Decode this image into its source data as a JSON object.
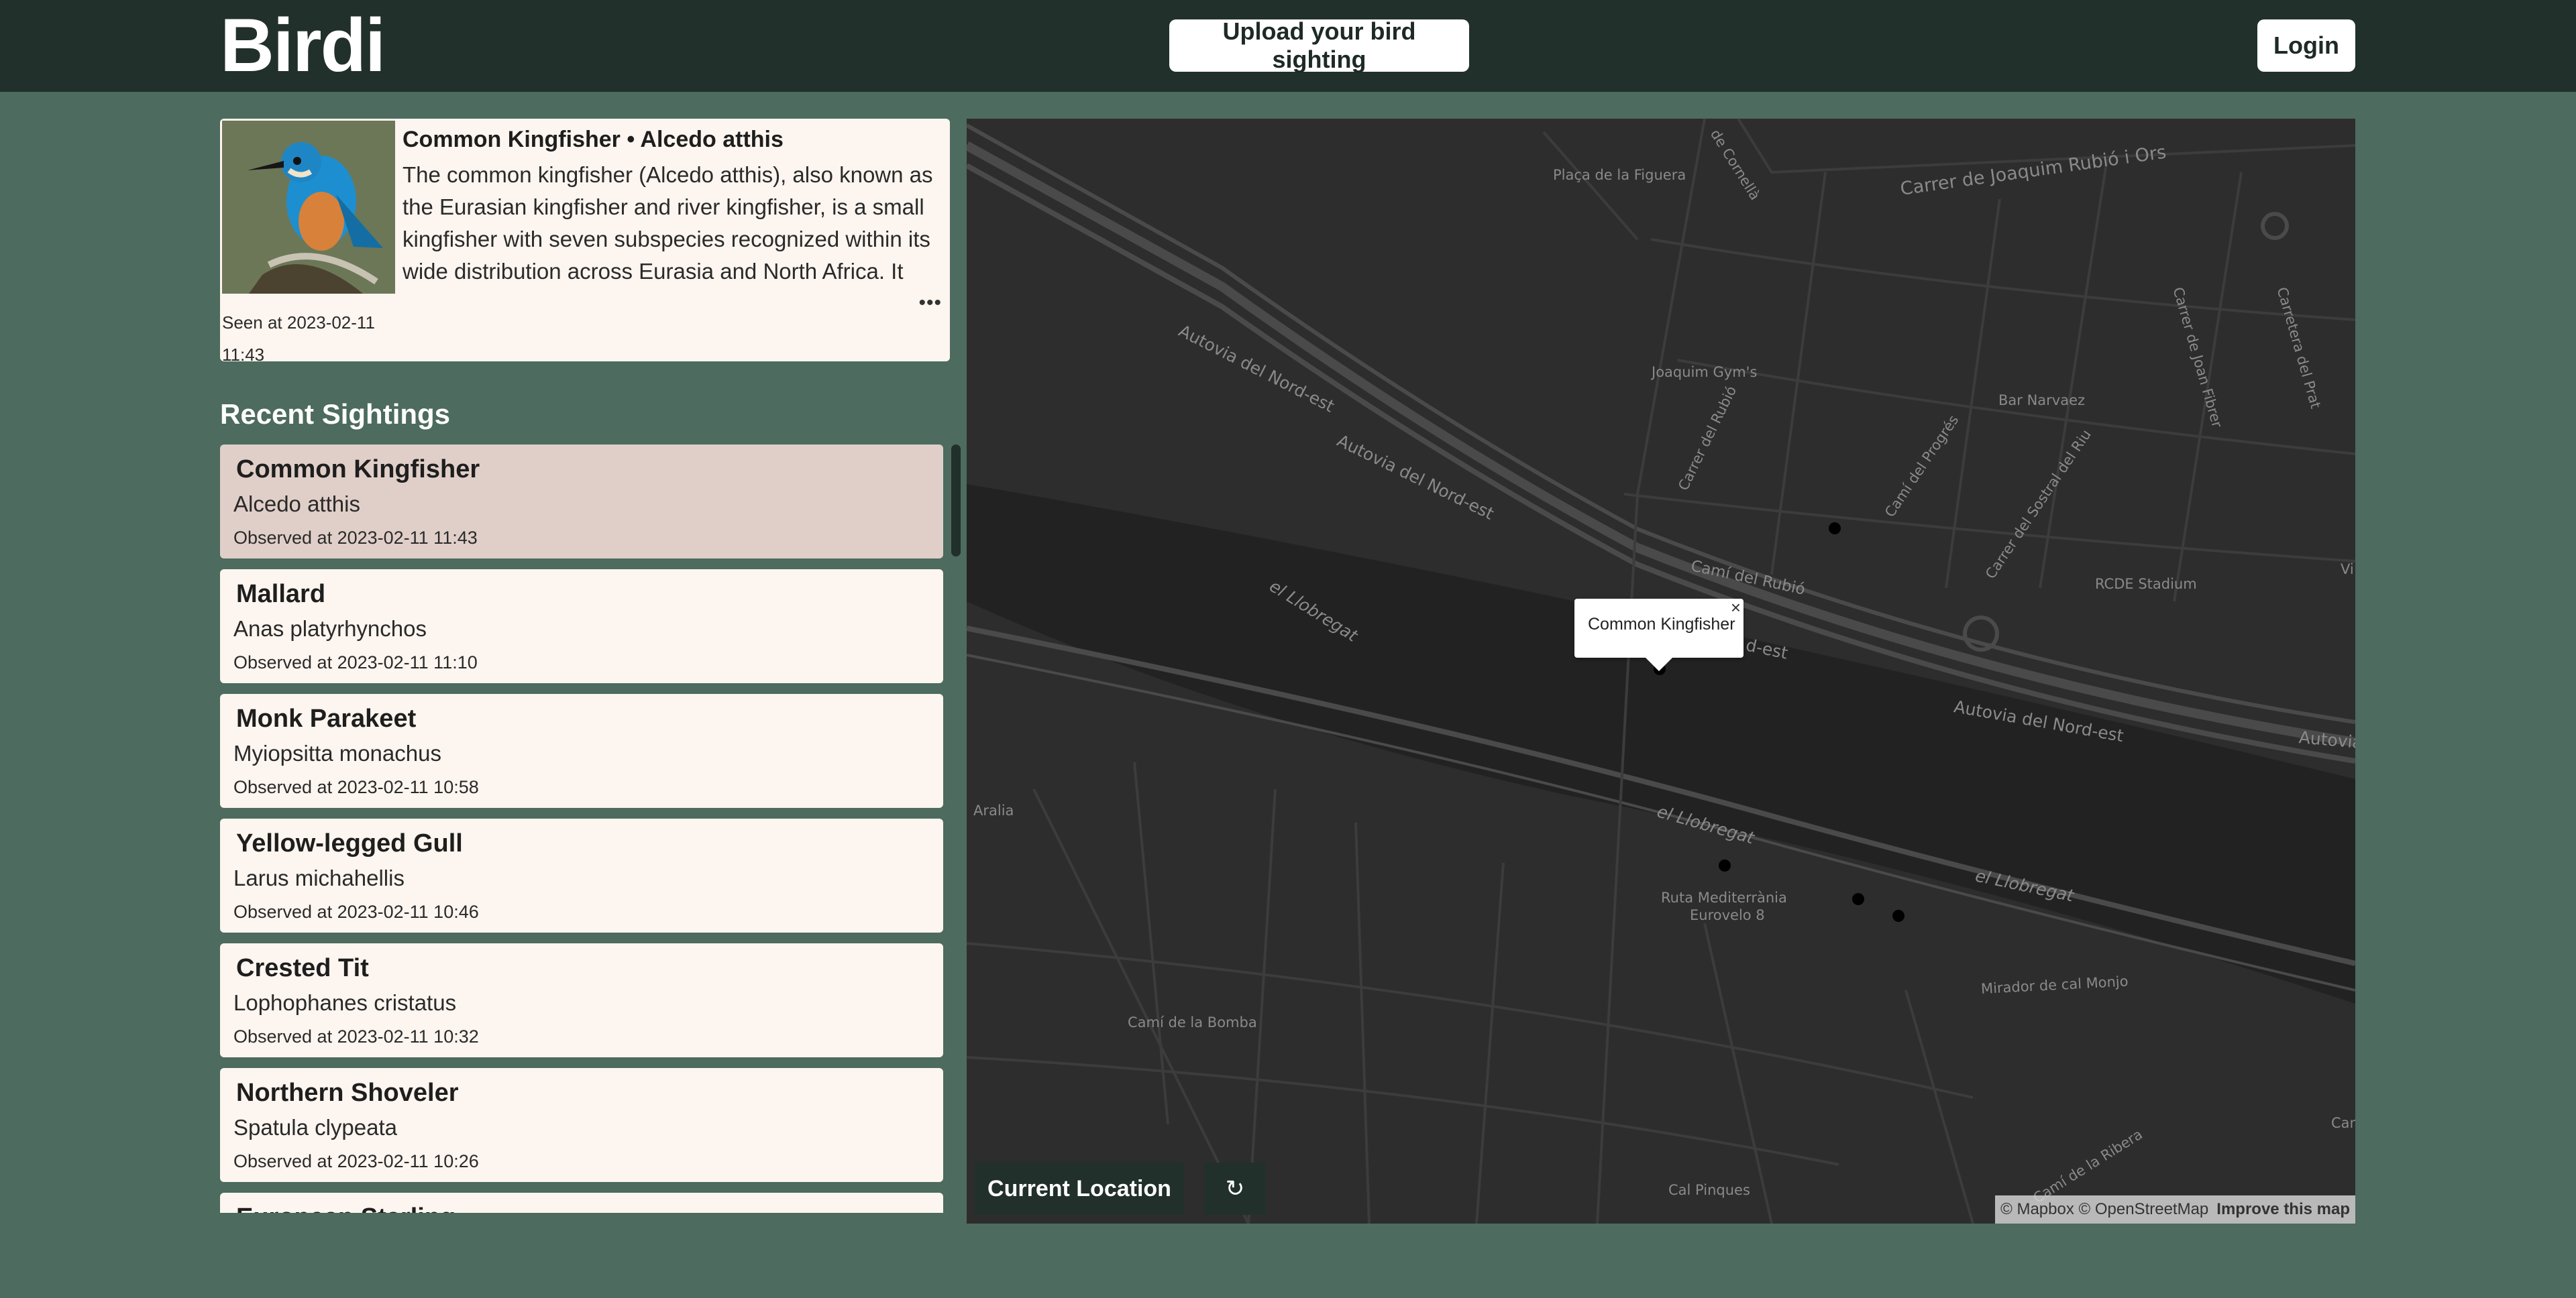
{
  "header": {
    "logo": "Birdi",
    "upload_label": "Upload your bird sighting",
    "login_label": "Login"
  },
  "featured": {
    "title": "Common Kingfisher • Alcedo atthis",
    "description": "The common kingfisher (Alcedo atthis), also known as the Eurasian kingfisher and river kingfisher, is a small kingfisher with seven subspecies recognized within its wide distribution across Eurasia and North Africa. It is...",
    "more": "•••",
    "seen_label": "Seen at 2023-02-11 11:43"
  },
  "recent": {
    "title": "Recent Sightings",
    "items": [
      {
        "name": "Common Kingfisher",
        "scientific": "Alcedo atthis",
        "observed": "Observed at 2023-02-11 11:43"
      },
      {
        "name": "Mallard",
        "scientific": "Anas platyrhynchos",
        "observed": "Observed at 2023-02-11 11:10"
      },
      {
        "name": "Monk Parakeet",
        "scientific": "Myiopsitta monachus",
        "observed": "Observed at 2023-02-11 10:58"
      },
      {
        "name": "Yellow-legged Gull",
        "scientific": "Larus michahellis",
        "observed": "Observed at 2023-02-11 10:46"
      },
      {
        "name": "Crested Tit",
        "scientific": "Lophophanes cristatus",
        "observed": "Observed at 2023-02-11 10:32"
      },
      {
        "name": "Northern Shoveler",
        "scientific": "Spatula clypeata",
        "observed": "Observed at 2023-02-11 10:26"
      },
      {
        "name": "European Starling",
        "scientific": "",
        "observed": ""
      }
    ]
  },
  "map": {
    "popup_text": "Common Kingfisher",
    "popup_close": "×",
    "current_location_label": "Current Location",
    "refresh_icon": "↻",
    "attribution": "© Mapbox © OpenStreetMap",
    "improve_label": "Improve this map",
    "labels": {
      "placa": "Plaça de la Figuera",
      "cornella": "de Cornellà",
      "joaquim": "Carrer de Joaquim Rubió i Ors",
      "autovia1": "Autovia del Nord-est",
      "autovia2": "Autovia del Nord-est",
      "joaquim_gyms": "Joaquim Gym's",
      "carrer_rubio": "Carrer del Rubió",
      "cami_progres": "Camí del Progrés",
      "carrer_sostral": "Carrer del Sostral del Riu",
      "joan_fibrer": "Carrer de Joan Fibrer",
      "carretera_prat": "Carretera del Prat",
      "bar_narvaez": "Bar Narvaez",
      "cami_rubio": "Camí del Rubió",
      "nord_est_frag": "d-est",
      "rcde": "RCDE Stadium",
      "autovia3": "Autovia del Nord-est",
      "autovia4": "Autovia",
      "llobregat1": "el Llobregat",
      "llobregat2": "el Llobregat",
      "llobregat3": "el Llobregat",
      "aralia": "Aralia",
      "ruta": "Ruta Mediterrània",
      "eurovelo": "Eurovelo 8",
      "mirador": "Mirador de cal Monjo",
      "bomba": "Camí de la Bomba",
      "pinques": "Cal Pinques",
      "ribera": "Camí de la Ribera",
      "can": "Can C",
      "vi": "Vi"
    }
  }
}
